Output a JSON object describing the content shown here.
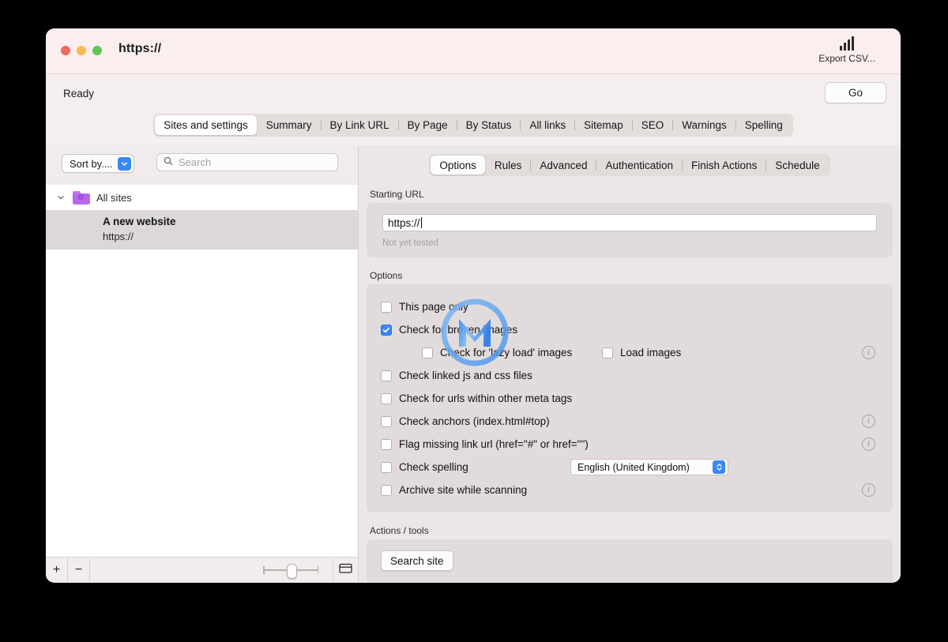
{
  "window": {
    "title": "https://",
    "traffic_lights": [
      "close",
      "minimize",
      "zoom"
    ]
  },
  "toolbar": {
    "export_label": "Export CSV...",
    "export_icon": "bar-chart-icon"
  },
  "status_bar": {
    "status": "Ready",
    "go_label": "Go"
  },
  "main_tabs": [
    {
      "label": "Sites and settings",
      "active": true
    },
    {
      "label": "Summary",
      "active": false
    },
    {
      "label": "By Link URL",
      "active": false
    },
    {
      "label": "By Page",
      "active": false
    },
    {
      "label": "By Status",
      "active": false
    },
    {
      "label": "All links",
      "active": false
    },
    {
      "label": "Sitemap",
      "active": false
    },
    {
      "label": "SEO",
      "active": false
    },
    {
      "label": "Warnings",
      "active": false
    },
    {
      "label": "Spelling",
      "active": false
    }
  ],
  "sidebar": {
    "sort_button_label": "Sort by....",
    "sort_icon": "chevron-down-icon",
    "search_placeholder": "Search",
    "search_value": "",
    "search_icon": "search-icon",
    "group": {
      "label": "All sites",
      "icon": "folder-gear-icon",
      "disclosure": "chevron-down-icon",
      "expanded": true
    },
    "sites": [
      {
        "name": "A new website",
        "url": "https://",
        "selected": true
      }
    ],
    "bottom_bar": {
      "add_label": "+",
      "remove_label": "−",
      "folder_icon": "folder-icon",
      "zoom_slider_value": 50
    }
  },
  "inner_tabs": [
    {
      "label": "Options",
      "active": true
    },
    {
      "label": "Rules",
      "active": false
    },
    {
      "label": "Advanced",
      "active": false
    },
    {
      "label": "Authentication",
      "active": false
    },
    {
      "label": "Finish Actions",
      "active": false
    },
    {
      "label": "Schedule",
      "active": false
    }
  ],
  "starting_url_section": {
    "label": "Starting URL",
    "value": "https://",
    "note": "Not yet tested"
  },
  "options_section": {
    "label": "Options",
    "rows": [
      {
        "label": "This page only",
        "checked": false,
        "info": false,
        "indent": false
      },
      {
        "label": "Check for broken images",
        "checked": true,
        "info": false,
        "indent": false
      },
      {
        "label": "Check for 'lazy load' images",
        "checked": false,
        "info": false,
        "indent": true
      },
      {
        "label": "Check linked js and css files",
        "checked": false,
        "info": false,
        "indent": false
      },
      {
        "label": "Check for urls within other meta tags",
        "checked": false,
        "info": false,
        "indent": false
      },
      {
        "label": "Check anchors (index.html#top)",
        "checked": false,
        "info": true,
        "indent": false
      },
      {
        "label": "Flag missing link url (href=\"#\" or href=\"\")",
        "checked": false,
        "info": true,
        "indent": false
      },
      {
        "label": "Check spelling",
        "checked": false,
        "info": false,
        "indent": false
      },
      {
        "label": "Archive site while scanning",
        "checked": false,
        "info": true,
        "indent": false
      }
    ],
    "load_images": {
      "label": "Load images",
      "checked": false,
      "info": true
    },
    "spelling_language": {
      "value": "English (United Kingdom)",
      "stepper_icon": "up-down-stepper-icon"
    }
  },
  "actions_section": {
    "label": "Actions / tools",
    "search_site_label": "Search site"
  },
  "watermark": {
    "name": "m-logo-watermark",
    "letter": "M"
  },
  "colors": {
    "accent_blue": "#3a87f7",
    "titlebar_pink": "#faeeee",
    "window_bg": "#ebe7e6",
    "folder_purple": "#b569e8",
    "selection_gray": "#dcd8d7"
  }
}
